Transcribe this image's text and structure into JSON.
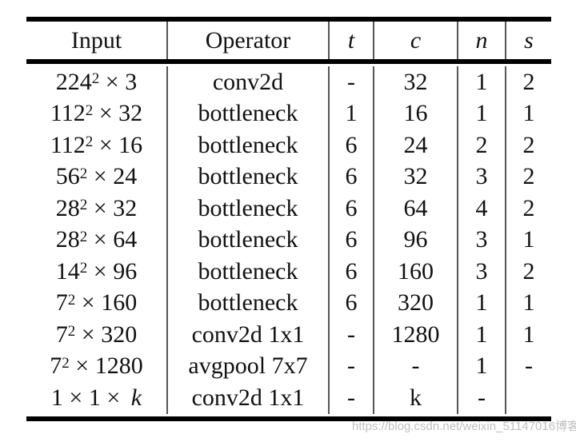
{
  "table": {
    "headers": [
      {
        "label": "Input",
        "italic": false
      },
      {
        "label": "Operator",
        "italic": false
      },
      {
        "label": "t",
        "italic": true
      },
      {
        "label": "c",
        "italic": true
      },
      {
        "label": "n",
        "italic": true
      },
      {
        "label": "s",
        "italic": true
      }
    ],
    "rows": [
      {
        "input_base": "224",
        "input_exp": "2",
        "input_rest": " × 3",
        "operator": "conv2d",
        "t": "-",
        "c": "32",
        "n": "1",
        "s": "2"
      },
      {
        "input_base": "112",
        "input_exp": "2",
        "input_rest": " × 32",
        "operator": "bottleneck",
        "t": "1",
        "c": "16",
        "n": "1",
        "s": "1"
      },
      {
        "input_base": "112",
        "input_exp": "2",
        "input_rest": " × 16",
        "operator": "bottleneck",
        "t": "6",
        "c": "24",
        "n": "2",
        "s": "2"
      },
      {
        "input_base": "56",
        "input_exp": "2",
        "input_rest": " × 24",
        "operator": "bottleneck",
        "t": "6",
        "c": "32",
        "n": "3",
        "s": "2"
      },
      {
        "input_base": "28",
        "input_exp": "2",
        "input_rest": " × 32",
        "operator": "bottleneck",
        "t": "6",
        "c": "64",
        "n": "4",
        "s": "2"
      },
      {
        "input_base": "28",
        "input_exp": "2",
        "input_rest": " × 64",
        "operator": "bottleneck",
        "t": "6",
        "c": "96",
        "n": "3",
        "s": "1"
      },
      {
        "input_base": "14",
        "input_exp": "2",
        "input_rest": " × 96",
        "operator": "bottleneck",
        "t": "6",
        "c": "160",
        "n": "3",
        "s": "2"
      },
      {
        "input_base": "7",
        "input_exp": "2",
        "input_rest": " × 160",
        "operator": "bottleneck",
        "t": "6",
        "c": "320",
        "n": "1",
        "s": "1"
      },
      {
        "input_base": "7",
        "input_exp": "2",
        "input_rest": " × 320",
        "operator": "conv2d 1x1",
        "t": "-",
        "c": "1280",
        "n": "1",
        "s": "1"
      },
      {
        "input_base": "7",
        "input_exp": "2",
        "input_rest": " × 1280",
        "operator": "avgpool 7x7",
        "t": "-",
        "c": "-",
        "n": "1",
        "s": "-"
      },
      {
        "input_base": "1 × 1 × ",
        "input_exp": "",
        "input_rest": "",
        "input_italic_tail": "k",
        "operator": "conv2d 1x1",
        "t": "-",
        "c": "k",
        "n": "-",
        "s": ""
      }
    ]
  },
  "watermark": "https://blog.csdn.net/weixin_51147016博客"
}
